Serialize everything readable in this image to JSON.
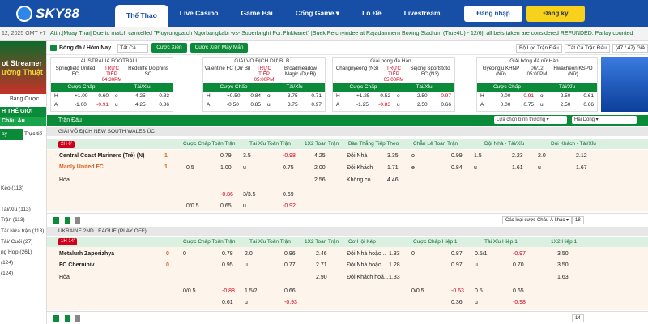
{
  "header": {
    "logo": "SKY88",
    "nav": [
      "Thể Thao",
      "Live Casino",
      "Game Bài",
      "Cổng Game ▾",
      "Lô Đề",
      "Livestream"
    ],
    "login": "Đăng nhập",
    "register": "Đăng ký"
  },
  "ticker": {
    "clock": "12, 2025 GMT +7",
    "text": "Attn:[Muay Thai] Due to match cancelled \"Ployrungpatch Ngorbangkabi -vs- Superbright Por.Phikkanet\" [Suek Petchyindee at Rajadamnern Boxing Stadium (True4U) - 12/6], all bets taken are considered REFUNDED. Parlay counted"
  },
  "sidebar": {
    "banner_line1": "ot Streamer",
    "banner_line2": "ường Thuật",
    "bang_cuoc": "Bảng Cược",
    "head1": "H THẾ GIỚI",
    "head2": "Châu Âu",
    "tab_on": "ay",
    "tab_off": "Trực tiế",
    "items": [
      "",
      "",
      "",
      "",
      "Kèo (113)",
      "",
      "Tài/Xỉu (113)",
      "Trận (113)",
      "Tà/ Nửa trận (113)",
      "Tài/ Cuối (27)",
      "ng Hợp (261)",
      "(124)",
      "(124)"
    ]
  },
  "section": {
    "title": "Bóng đá / Hôm Nay",
    "select": "Tất Cả",
    "pill1": "Cược Xiên",
    "pill2": "Cược Xiên May Mắn",
    "filter": "Bộ Lọc Trận Đấu",
    "sort": "Tất Cả Trận Đấu",
    "count": "(47 / 47) Giả"
  },
  "cards": [
    {
      "league": "AUSTRALIA FOOTBALL...",
      "home": "Springfield United FC",
      "live": "TRỰC TIẾP",
      "time": "04:30PM",
      "away": "Redcliffe Dolphins SC",
      "hcp": "Cược Chấp",
      "ou": "Tài/Xỉu",
      "r1": [
        "H",
        "+1.00",
        "0.60",
        "o",
        "4.25",
        "0.83"
      ],
      "r2": [
        "A",
        "-1.00",
        "-0.91",
        "u",
        "4.25",
        "0.86"
      ]
    },
    {
      "league": "GIẢI VÔ ĐỊCH DỰ BỊ B...",
      "home": "Valentine FC (Dự Bị)",
      "live": "TRỰC TIẾP",
      "time": "05:00PM",
      "away": "Broadmeadow Magic (Dự Bị)",
      "hcp": "Cược Chấp",
      "ou": "Tài/Xỉu",
      "r1": [
        "H",
        "+0.50",
        "0.84",
        "o",
        "3.75",
        "0.71"
      ],
      "r2": [
        "A",
        "-0.50",
        "0.85",
        "u",
        "3.75",
        "0.97"
      ]
    },
    {
      "league": "Giải bóng đá Hàn ...",
      "home": "Changnyeong (N3)",
      "live": "TRỰC TIẾP",
      "time": "05:00PM",
      "away": "Sejong Sportstoto FC (N3)",
      "hcp": "Cược Chấp",
      "ou": "Tài/Xỉu",
      "r1": [
        "H",
        "+1.25",
        "0.52",
        "o",
        "2.50",
        "-0.97"
      ],
      "r2": [
        "A",
        "-1.25",
        "-0.83",
        "u",
        "2.50",
        "0.66"
      ]
    },
    {
      "league": "Giải bóng đá nữ Hàn ...",
      "home": "Gyeongju KHNP (Nữ)",
      "live": "06/12",
      "time": "05:00PM",
      "away": "Hwacheon KSPO (Nữ)",
      "hcp": "Cược Chấp",
      "ou": "Tài/Xỉu",
      "r1": [
        "H",
        "0.00",
        "-0.91",
        "o",
        "2.50",
        "0.61"
      ],
      "r2": [
        "A",
        "0.00",
        "0.75",
        "u",
        "2.50",
        "0.66"
      ]
    }
  ],
  "main_bar": {
    "title": "Trận Đấu",
    "sort": "Lựa chọn bình thường ▾",
    "type": "Hai Dòng ▾"
  },
  "league1": {
    "name": "GIẢI VÔ ĐỊCH NEW SOUTH WALES ÚC",
    "cols": [
      "Cược Chấp Toàn Trận",
      "Tài Xỉu Toàn Trận",
      "1X2 Toàn Trận",
      "Bàn Thắng Tiếp Theo",
      "Chẵn Lẻ Toàn Trận",
      "Đội Nhà - Tài/Xỉu",
      "Đội Khách - Tài/Xỉu"
    ],
    "live": "2H 6'",
    "home": "Central Coast Mariners (Trẻ) (N)",
    "away": "Manly United FC",
    "draw": "Hòa",
    "home_score": "1",
    "away_score": "1",
    "r1": [
      "",
      "0.79",
      "3.5",
      "-0.98",
      "4.25",
      "Đội Nhà",
      "3.35",
      "o",
      "0.99",
      "1.5",
      "2.23",
      "2.0",
      "2.12"
    ],
    "r2": [
      "0.5",
      "1.00",
      "u",
      "0.75",
      "2.00",
      "Đội Khách",
      "1.71",
      "e",
      "0.84",
      "u",
      "1.61",
      "u",
      "1.67"
    ],
    "r3": [
      "",
      "",
      "",
      "",
      "2.56",
      "Không có",
      "4.46",
      "",
      "",
      "",
      "",
      "",
      ""
    ],
    "r4": [
      "",
      "-0.86",
      "3/3.5",
      "0.69"
    ],
    "r5": [
      "0/0.5",
      "0.65",
      "u",
      "-0.92"
    ],
    "more": "Các loại cược Châu Á khác ▾",
    "page": "18"
  },
  "league2": {
    "name": "UKRAINE 2ND LEAGUE (PLAY OFF)",
    "cols": [
      "Cược Chấp Toàn Trận",
      "Tài Xỉu Toàn Trận",
      "1X2 Toàn Trận",
      "Cơ Hội Kép",
      "Cược Chấp Hiệp 1",
      "Tài Xỉu Hiệp 1",
      "1X2 Hiệp 1"
    ],
    "live": "1H 14'",
    "home": "Metalurh Zaporizhya",
    "away": "FC Chernihiv",
    "draw": "Hòa",
    "home_score": "0",
    "away_score": "0",
    "r1": [
      "0",
      "0.78",
      "2.0",
      "0.96",
      "2.46",
      "Đội Nhà hoặc...",
      "1.33",
      "0",
      "0.87",
      "0.5/1",
      "-0.97",
      "3.50"
    ],
    "r2": [
      "",
      "0.95",
      "u",
      "0.77",
      "2.71",
      "Đội Nhà hoặc...",
      "1.28",
      "",
      "0.97",
      "u",
      "0.70",
      "3.50"
    ],
    "r3": [
      "",
      "",
      "",
      "",
      "2.90",
      "Đội Khách hoặ...",
      "1.33",
      "",
      "",
      "",
      "",
      "1.63"
    ],
    "r4": [
      "0/0.5",
      "-0.88",
      "1.5/2",
      "0.66",
      "",
      "",
      "",
      "0/0.5",
      "-0.63",
      "0.5",
      "0.65"
    ],
    "r5": [
      "",
      "0.61",
      "u",
      "-0.93",
      "",
      "",
      "",
      "",
      "0.36",
      "u",
      "-0.98"
    ],
    "page": "14"
  },
  "colors": {
    "brand": "#174ea6",
    "green": "#0b8a3a",
    "accent": "#f7d11b",
    "negative": "#d0021b"
  }
}
